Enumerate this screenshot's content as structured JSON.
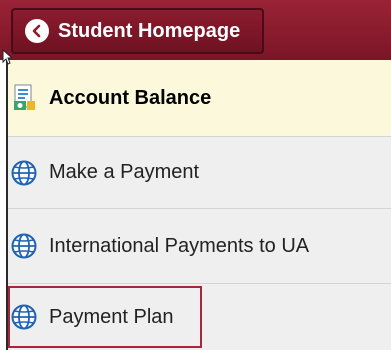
{
  "header": {
    "back_label": "Student Homepage"
  },
  "menu": {
    "items": [
      {
        "label": "Account Balance",
        "icon": "account-balance-icon",
        "active": true
      },
      {
        "label": "Make a Payment",
        "icon": "globe-icon"
      },
      {
        "label": "International Payments to UA",
        "icon": "globe-icon"
      },
      {
        "label": "Payment Plan",
        "icon": "globe-icon",
        "highlighted": true
      }
    ]
  },
  "colors": {
    "header": "#8c1b2e",
    "active_bg": "#fcf8dc",
    "item_bg": "#efefef",
    "highlight": "#a3283b",
    "globe": "#1f63b4"
  }
}
